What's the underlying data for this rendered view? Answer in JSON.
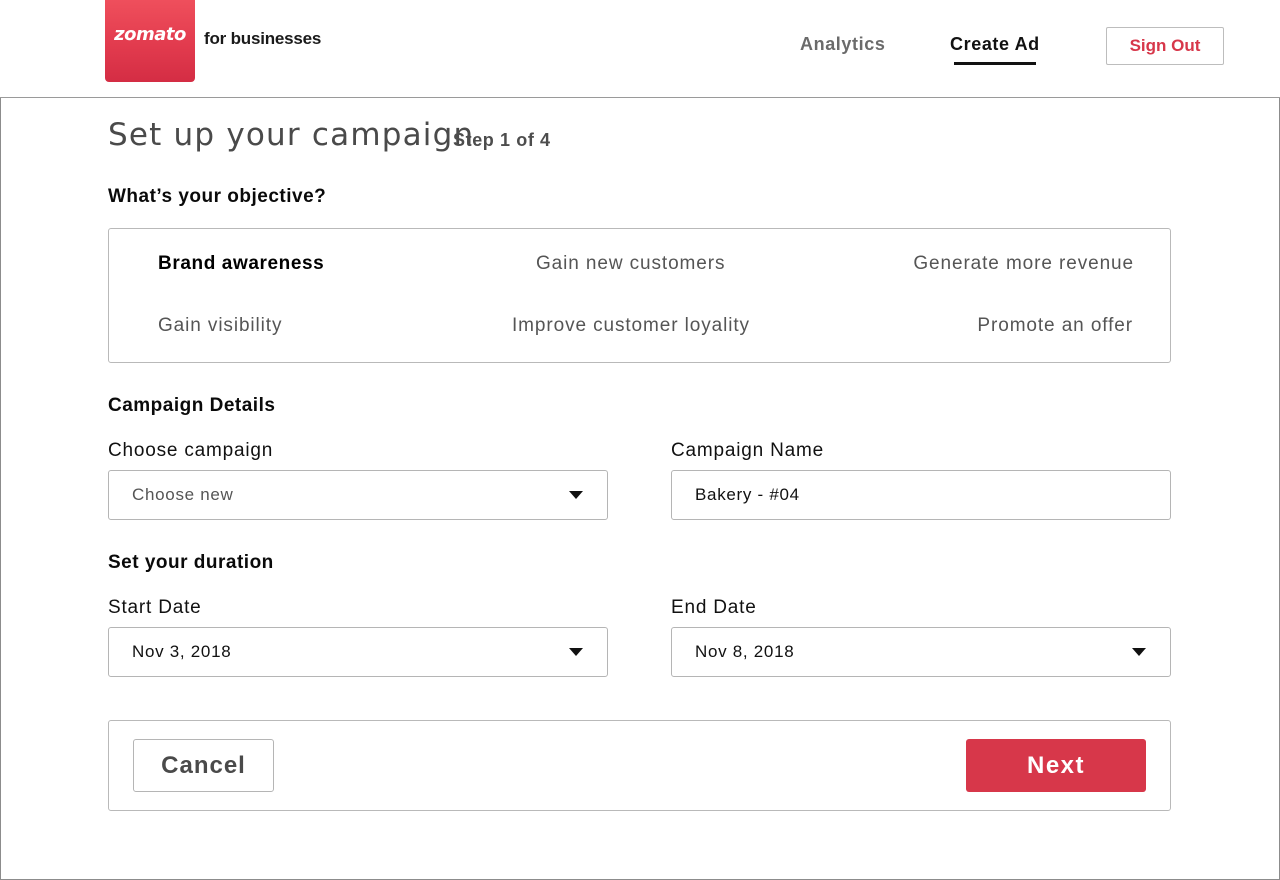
{
  "header": {
    "logo_text": "zomato",
    "logo_suffix": "for businesses",
    "nav": {
      "analytics": "Analytics",
      "create_ad": "Create Ad"
    },
    "sign_out": "Sign Out"
  },
  "page": {
    "title": "Set up your campaign",
    "step": "Step 1 of 4"
  },
  "objective": {
    "heading": "What’s your objective?",
    "options": [
      {
        "label": "Brand awareness",
        "selected": true
      },
      {
        "label": "Gain new customers",
        "selected": false
      },
      {
        "label": "Generate more revenue",
        "selected": false
      },
      {
        "label": "Gain visibility",
        "selected": false
      },
      {
        "label": "Improve customer loyality",
        "selected": false
      },
      {
        "label": "Promote an offer",
        "selected": false
      }
    ]
  },
  "campaign_details": {
    "heading": "Campaign Details",
    "choose_label": "Choose campaign",
    "choose_value": "Choose new",
    "name_label": "Campaign Name",
    "name_value": "Bakery - #04"
  },
  "duration": {
    "heading": "Set your duration",
    "start_label": "Start Date",
    "start_value": "Nov 3, 2018",
    "end_label": "End Date",
    "end_value": "Nov 8, 2018"
  },
  "actions": {
    "cancel": "Cancel",
    "next": "Next"
  },
  "colors": {
    "brand": "#d7374a",
    "logo_gradient_top": "#ef4f5c"
  },
  "icons": {
    "dropdown": "caret-down-icon"
  }
}
